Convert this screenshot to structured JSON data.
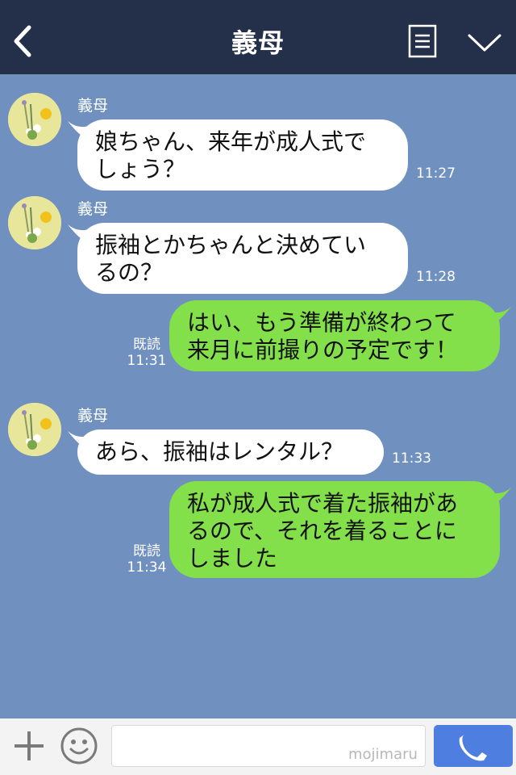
{
  "header": {
    "title": "義母"
  },
  "messages": [
    {
      "sender": "義母",
      "lines": [
        "娘ちゃん、来年が成人式で",
        "しょう？"
      ],
      "time": "11:27"
    },
    {
      "sender": "義母",
      "lines": [
        "振袖とかちゃんと決めてい",
        "るの？"
      ],
      "time": "11:28"
    },
    {
      "lines": [
        "はい、もう準備が終わって",
        "来月に前撮りの予定です！"
      ],
      "read": "既読",
      "time": "11:31"
    },
    {
      "sender": "義母",
      "lines": [
        "あら、振袖はレンタル？"
      ],
      "time": "11:33"
    },
    {
      "lines": [
        "私が成人式で着た振袖があ",
        "るので、それを着ることに",
        "しました"
      ],
      "read": "既読",
      "time": "11:34"
    }
  ],
  "footer": {
    "watermark": "mojimaru"
  },
  "colors": {
    "background": "#7090c0",
    "header": "#24304a",
    "incoming_bubble": "#ffffff",
    "outgoing_bubble": "#84e04a",
    "call_button": "#4e7fe0"
  },
  "icons": [
    "back-arrow-icon",
    "menu-icon",
    "chevron-down-icon",
    "plus-icon",
    "emoji-icon",
    "phone-icon"
  ]
}
